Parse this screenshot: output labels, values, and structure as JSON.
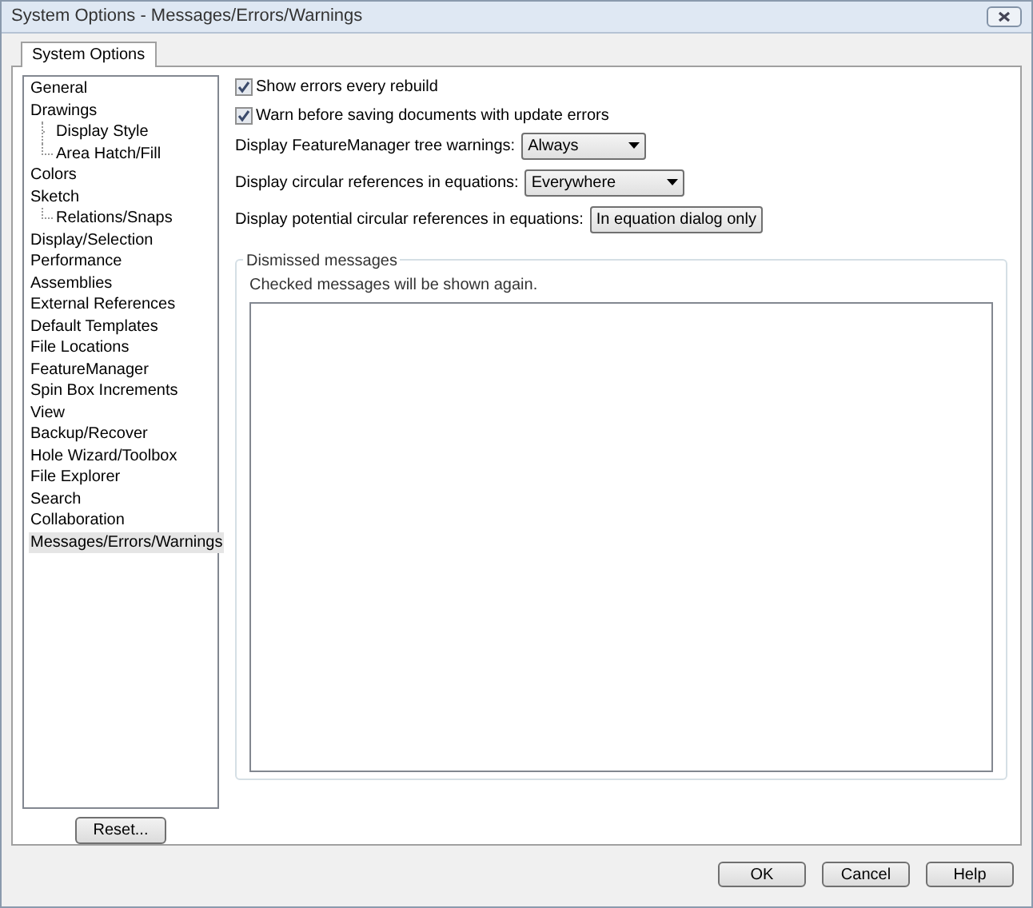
{
  "window": {
    "title": "System Options - Messages/Errors/Warnings"
  },
  "tabs": [
    {
      "label": "System Options",
      "selected": true
    }
  ],
  "tree": [
    {
      "label": "General",
      "selected": false
    },
    {
      "label": "Drawings",
      "selected": false,
      "children": [
        {
          "label": "Display Style",
          "selected": false
        },
        {
          "label": "Area Hatch/Fill",
          "selected": false
        }
      ]
    },
    {
      "label": "Colors",
      "selected": false
    },
    {
      "label": "Sketch",
      "selected": false,
      "children": [
        {
          "label": "Relations/Snaps",
          "selected": false
        }
      ]
    },
    {
      "label": "Display/Selection",
      "selected": false
    },
    {
      "label": "Performance",
      "selected": false
    },
    {
      "label": "Assemblies",
      "selected": false
    },
    {
      "label": "External References",
      "selected": false
    },
    {
      "label": "Default Templates",
      "selected": false
    },
    {
      "label": "File Locations",
      "selected": false
    },
    {
      "label": "FeatureManager",
      "selected": false
    },
    {
      "label": "Spin Box Increments",
      "selected": false
    },
    {
      "label": "View",
      "selected": false
    },
    {
      "label": "Backup/Recover",
      "selected": false
    },
    {
      "label": "Hole Wizard/Toolbox",
      "selected": false
    },
    {
      "label": "File Explorer",
      "selected": false
    },
    {
      "label": "Search",
      "selected": false
    },
    {
      "label": "Collaboration",
      "selected": false
    },
    {
      "label": "Messages/Errors/Warnings",
      "selected": true
    }
  ],
  "reset_button": "Reset...",
  "checkboxes": [
    {
      "label": "Show errors every rebuild",
      "checked": true
    },
    {
      "label": "Warn before saving documents with update errors",
      "checked": true
    }
  ],
  "dropdowns": [
    {
      "label": "Display FeatureManager tree warnings:",
      "value": "Always"
    },
    {
      "label": "Display circular references in equations:",
      "value": "Everywhere"
    },
    {
      "label": "Display potential circular references in equations:",
      "value": "In equation dialog only"
    }
  ],
  "dismissed": {
    "title": "Dismissed messages",
    "hint": "Checked messages will be shown again."
  },
  "buttons": [
    "OK",
    "Cancel",
    "Help"
  ]
}
